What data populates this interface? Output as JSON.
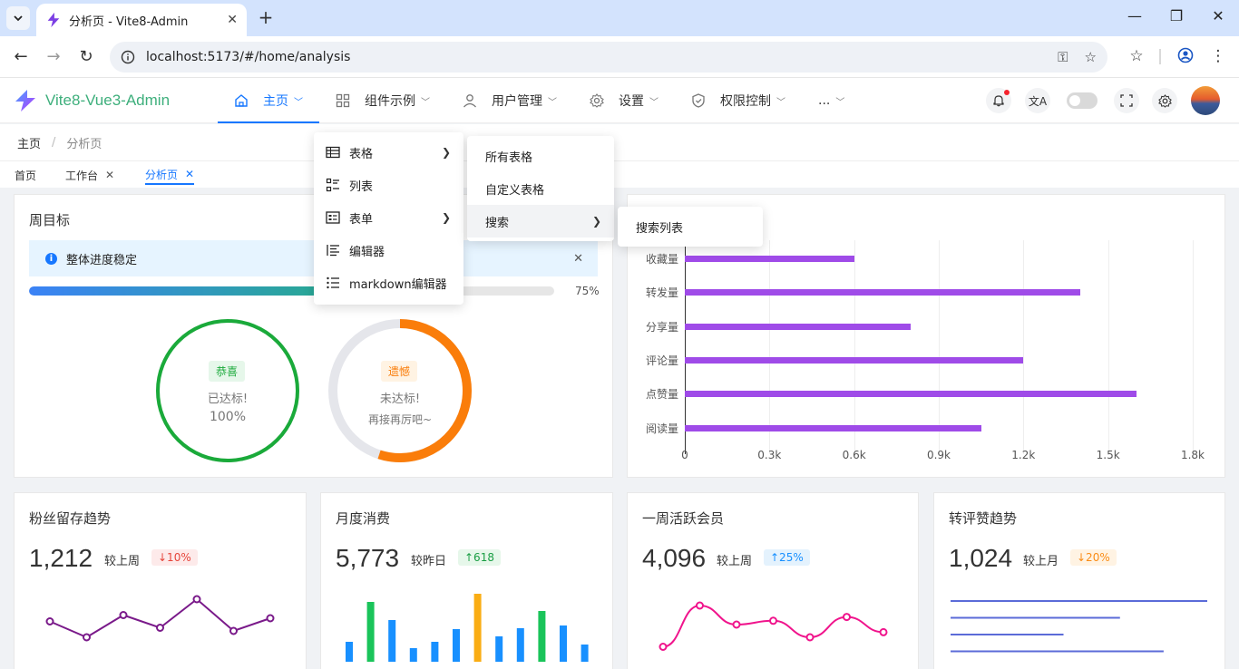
{
  "browser": {
    "tab_title": "分析页 - Vite8-Admin",
    "url": "localhost:5173/#/home/analysis"
  },
  "app": {
    "logo_text": "Vite8-Vue3-Admin",
    "nav": [
      {
        "label": "主页",
        "icon": "home-icon"
      },
      {
        "label": "组件示例",
        "icon": "grid-icon"
      },
      {
        "label": "用户管理",
        "icon": "user-icon"
      },
      {
        "label": "设置",
        "icon": "gear-icon"
      },
      {
        "label": "权限控制",
        "icon": "shield-icon"
      },
      {
        "label": "...",
        "icon": ""
      }
    ],
    "accent_color": "#1677ff"
  },
  "breadcrumb": {
    "home": "主页",
    "separator": "/",
    "current": "分析页"
  },
  "page_tabs": [
    {
      "label": "首页"
    },
    {
      "label": "工作台"
    },
    {
      "label": "分析页"
    }
  ],
  "menus": {
    "level1": [
      {
        "label": "表格",
        "icon": "table-icon",
        "has_sub": true
      },
      {
        "label": "列表",
        "icon": "list-check-icon",
        "has_sub": false
      },
      {
        "label": "表单",
        "icon": "form-icon",
        "has_sub": true
      },
      {
        "label": "编辑器",
        "icon": "editor-icon",
        "has_sub": false
      },
      {
        "label": "markdown编辑器",
        "icon": "markdown-list-icon",
        "has_sub": false
      }
    ],
    "level2": [
      {
        "label": "所有表格"
      },
      {
        "label": "自定义表格"
      },
      {
        "label": "搜索"
      }
    ],
    "level3": [
      {
        "label": "搜索列表"
      }
    ]
  },
  "weekly_goal": {
    "title": "周目标",
    "alert_text": "整体进度稳定",
    "progress": 0.75,
    "progress_label": "75%",
    "ring1": {
      "tag": "恭喜",
      "line1": "已达标!",
      "line2": "100%",
      "value": 1.0,
      "color": "#1aaa3a"
    },
    "ring2": {
      "tag": "遗憾",
      "line1": "未达标!",
      "line2": "再接再厉吧~",
      "value": 0.55,
      "color": "#fa7d0a"
    }
  },
  "chart_data": [
    {
      "type": "bar",
      "orientation": "horizontal",
      "categories": [
        "收藏量",
        "转发量",
        "分享量",
        "评论量",
        "点赞量",
        "阅读量"
      ],
      "values": [
        600,
        1400,
        800,
        1200,
        1600,
        1050
      ],
      "xticks": [
        "0",
        "0.3k",
        "0.6k",
        "0.9k",
        "1.2k",
        "1.5k",
        "1.8k"
      ],
      "xlim": [
        0,
        1800
      ],
      "color": "#9f4be8"
    },
    {
      "type": "line",
      "title": "粉丝留存趋势",
      "values": [
        55,
        30,
        65,
        45,
        90,
        40,
        60
      ],
      "color": "#7a1a8a"
    },
    {
      "type": "bar",
      "title": "月度消费",
      "values": [
        22,
        66,
        46,
        15,
        22,
        36,
        75,
        28,
        37,
        56,
        40,
        19
      ],
      "colors": [
        "#1890ff",
        "#1ac45a",
        "#1890ff",
        "#1890ff",
        "#1890ff",
        "#1890ff",
        "#faad14",
        "#1890ff",
        "#1890ff",
        "#1ac45a",
        "#1890ff",
        "#1890ff"
      ]
    },
    {
      "type": "line",
      "title": "一周活跃会员",
      "values": [
        15,
        80,
        50,
        56,
        30,
        62,
        38
      ],
      "color": "#f0148c"
    },
    {
      "type": "bar",
      "orientation": "horizontal",
      "title": "转评赞趋势",
      "values": [
        100,
        66,
        44,
        83
      ],
      "color": "#5b6bd8"
    }
  ],
  "stats": [
    {
      "title": "粉丝留存趋势",
      "value": "1,212",
      "compare": "较上周",
      "badge": "↓10%",
      "badge_style": "red"
    },
    {
      "title": "月度消费",
      "value": "5,773",
      "compare": "较昨日",
      "badge": "↑618",
      "badge_style": "green"
    },
    {
      "title": "一周活跃会员",
      "value": "4,096",
      "compare": "较上周",
      "badge": "↑25%",
      "badge_style": "blue"
    },
    {
      "title": "转评赞趋势",
      "value": "1,024",
      "compare": "较上月",
      "badge": "↓20%",
      "badge_style": "orange"
    }
  ]
}
